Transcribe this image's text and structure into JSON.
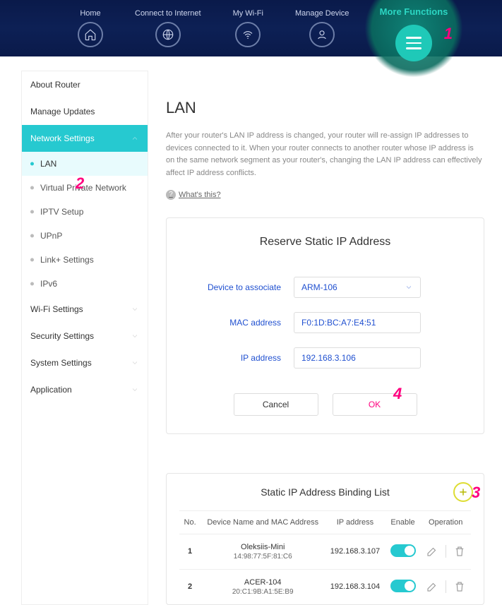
{
  "topnav": {
    "items": [
      {
        "label": "Home",
        "icon": "home-icon"
      },
      {
        "label": "Connect to Internet",
        "icon": "globe-icon"
      },
      {
        "label": "My Wi-Fi",
        "icon": "wifi-icon"
      },
      {
        "label": "Manage Device",
        "icon": "user-icon"
      }
    ],
    "more_label": "More Functions"
  },
  "annotations": {
    "n1": "1",
    "n2": "2",
    "n3": "3",
    "n4": "4"
  },
  "sidebar": {
    "about": "About Router",
    "updates": "Manage Updates",
    "network": "Network Settings",
    "subs": [
      {
        "label": "LAN"
      },
      {
        "label": "Virtual Private Network"
      },
      {
        "label": "IPTV Setup"
      },
      {
        "label": "UPnP"
      },
      {
        "label": "Link+ Settings"
      },
      {
        "label": "IPv6"
      }
    ],
    "wifi": "Wi-Fi Settings",
    "security": "Security Settings",
    "system": "System Settings",
    "application": "Application"
  },
  "page": {
    "title": "LAN",
    "description": "After your router's LAN IP address is changed, your router will re-assign IP addresses to devices connected to it. When your router connects to another router whose IP address is on the same network segment as your router's, changing the LAN IP address can effectively affect IP address conflicts.",
    "whats_this": "What's this?"
  },
  "reserve": {
    "title": "Reserve Static IP Address",
    "device_label": "Device to associate",
    "device_value": "ARM-106",
    "mac_label": "MAC address",
    "mac_value": "F0:1D:BC:A7:E4:51",
    "ip_label": "IP address",
    "ip_value": "192.168.3.106",
    "cancel": "Cancel",
    "ok": "OK"
  },
  "binding": {
    "title": "Static IP Address Binding List",
    "headers": {
      "no": "No.",
      "device": "Device Name and MAC Address",
      "ip": "IP address",
      "enable": "Enable",
      "operation": "Operation"
    },
    "rows": [
      {
        "no": "1",
        "name": "Oleksiis-Mini",
        "mac": "14:98:77:5F:81:C6",
        "ip": "192.168.3.107",
        "enabled": true
      },
      {
        "no": "2",
        "name": "ACER-104",
        "mac": "20:C1:9B:A1:5E:B9",
        "ip": "192.168.3.104",
        "enabled": true
      }
    ]
  }
}
